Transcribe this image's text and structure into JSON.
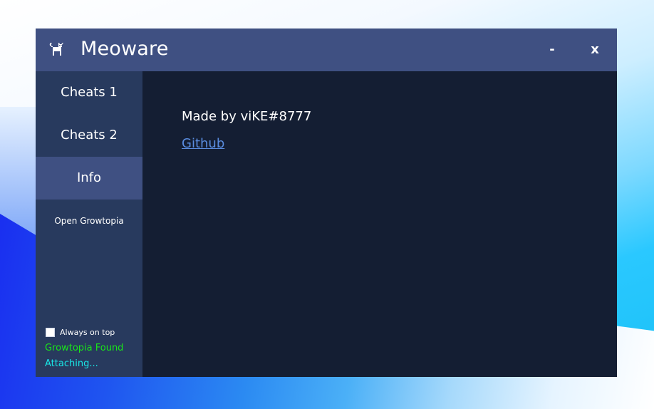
{
  "window": {
    "title": "Meoware",
    "icon": "cat-icon",
    "minimize_label": "-",
    "close_label": "x"
  },
  "sidebar": {
    "items": [
      {
        "label": "Cheats 1",
        "active": false
      },
      {
        "label": "Cheats 2",
        "active": false
      },
      {
        "label": "Info",
        "active": true
      }
    ],
    "open_button_label": "Open Growtopia",
    "always_on_top": {
      "label": "Always on top",
      "checked": false
    },
    "status": {
      "found": {
        "text": "Growtopia Found",
        "color": "#19e619"
      },
      "attaching": {
        "text": "Attaching...",
        "color": "#19e6e6"
      }
    }
  },
  "content": {
    "made_by": "Made by viKE#8777",
    "github_label": "Github"
  },
  "colors": {
    "titlebar": "#3f5082",
    "sidebar": "#283a5e",
    "active_item": "#3f5082",
    "content_bg": "#141e33",
    "link": "#5a8de0"
  }
}
